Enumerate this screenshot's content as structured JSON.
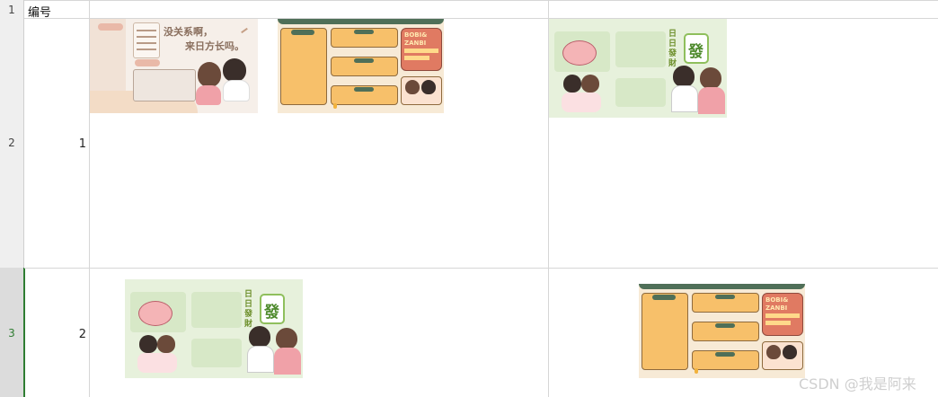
{
  "sheet": {
    "header_row": {
      "row_number": "1",
      "label": "编号"
    },
    "rows": [
      {
        "row_number": "2",
        "value": "1"
      },
      {
        "row_number": "3",
        "value": "2"
      }
    ]
  },
  "images": {
    "pink_note": {
      "headline_line1": "没关系啊，",
      "headline_line2": "来日方长吗。"
    },
    "orange_schedule": {
      "brand_line1": "BOBI&",
      "brand_line2": "ZANBI",
      "colors": {
        "top_bar": "#4f6f58",
        "panel": "#f7c06a",
        "brand": "#e07a62"
      }
    },
    "green_tile": {
      "tile_char": "發",
      "side_chars": "日日發財"
    }
  },
  "watermark": "CSDN @我是阿来"
}
